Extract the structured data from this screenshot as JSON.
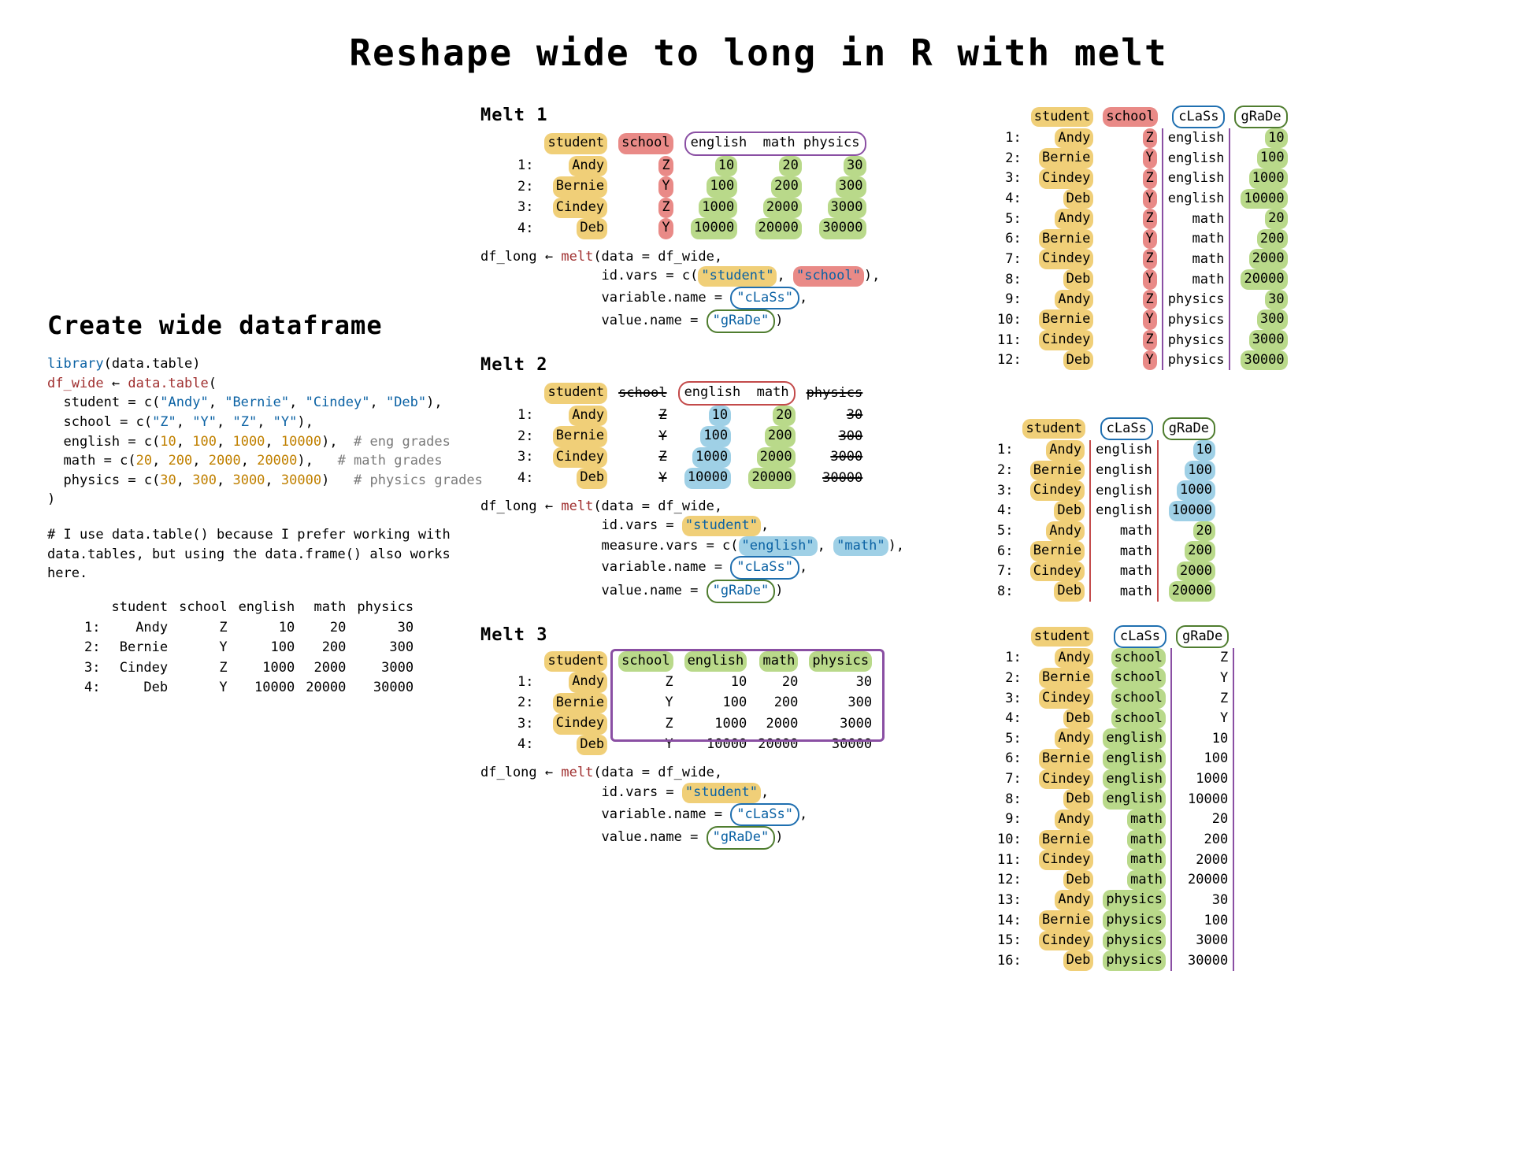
{
  "title": "Reshape wide to long in R with melt",
  "left": {
    "heading": "Create wide dataframe",
    "code": "library(data.table)\ndf_wide ← data.table(\n  student = c(\"Andy\", \"Bernie\", \"Cindey\", \"Deb\"),\n  school = c(\"Z\", \"Y\", \"Z\", \"Y\"),\n  english = c(10, 100, 1000, 10000),  # eng grades\n  math = c(20, 200, 2000, 20000),   # math grades\n  physics = c(30, 300, 3000, 30000)   # physics grades\n)",
    "note_pre": "# I use ",
    "note_dt": "data.table()",
    "note_mid": " because I prefer working with data.tables, but using the ",
    "note_df": "data.frame()",
    "note_post": " also works here.",
    "wide_table": {
      "headers": [
        "",
        "student",
        "school",
        "english",
        "math",
        "physics"
      ],
      "rows": [
        [
          "1:",
          "Andy",
          "Z",
          "10",
          "20",
          "30"
        ],
        [
          "2:",
          "Bernie",
          "Y",
          "100",
          "200",
          "300"
        ],
        [
          "3:",
          "Cindey",
          "Z",
          "1000",
          "2000",
          "3000"
        ],
        [
          "4:",
          "Deb",
          "Y",
          "10000",
          "20000",
          "30000"
        ]
      ]
    }
  },
  "melt1": {
    "heading": "Melt 1",
    "input_headers": [
      "",
      "student",
      "school",
      "english",
      "math",
      "physics"
    ],
    "input_rows": [
      [
        "1:",
        "Andy",
        "Z",
        "10",
        "20",
        "30"
      ],
      [
        "2:",
        "Bernie",
        "Y",
        "100",
        "200",
        "300"
      ],
      [
        "3:",
        "Cindey",
        "Z",
        "1000",
        "2000",
        "3000"
      ],
      [
        "4:",
        "Deb",
        "Y",
        "10000",
        "20000",
        "30000"
      ]
    ],
    "call_lines": {
      "l1_a": "df_long ← ",
      "l1_b": "melt",
      "l1_c": "(data = df_wide,",
      "l2_a": "id.vars = c(",
      "l2_s1": "\"student\"",
      "l2_b": ", ",
      "l2_s2": "\"school\"",
      "l2_c": "),",
      "l3_a": "variable.name = ",
      "l3_v": "\"cLaSs\"",
      "l3_c": ",",
      "l4_a": "value.name = ",
      "l4_v": "\"gRaDe\"",
      "l4_c": ")"
    },
    "out_headers": [
      "",
      "student",
      "school",
      "cLaSs",
      "gRaDe"
    ],
    "out_rows": [
      [
        "1:",
        "Andy",
        "Z",
        "english",
        "10"
      ],
      [
        "2:",
        "Bernie",
        "Y",
        "english",
        "100"
      ],
      [
        "3:",
        "Cindey",
        "Z",
        "english",
        "1000"
      ],
      [
        "4:",
        "Deb",
        "Y",
        "english",
        "10000"
      ],
      [
        "5:",
        "Andy",
        "Z",
        "math",
        "20"
      ],
      [
        "6:",
        "Bernie",
        "Y",
        "math",
        "200"
      ],
      [
        "7:",
        "Cindey",
        "Z",
        "math",
        "2000"
      ],
      [
        "8:",
        "Deb",
        "Y",
        "math",
        "20000"
      ],
      [
        "9:",
        "Andy",
        "Z",
        "physics",
        "30"
      ],
      [
        "10:",
        "Bernie",
        "Y",
        "physics",
        "300"
      ],
      [
        "11:",
        "Cindey",
        "Z",
        "physics",
        "3000"
      ],
      [
        "12:",
        "Deb",
        "Y",
        "physics",
        "30000"
      ]
    ]
  },
  "melt2": {
    "heading": "Melt 2",
    "input_headers": [
      "",
      "student",
      "school",
      "english",
      "math",
      "physics"
    ],
    "input_rows": [
      [
        "1:",
        "Andy",
        "Z",
        "10",
        "20",
        "30"
      ],
      [
        "2:",
        "Bernie",
        "Y",
        "100",
        "200",
        "300"
      ],
      [
        "3:",
        "Cindey",
        "Z",
        "1000",
        "2000",
        "3000"
      ],
      [
        "4:",
        "Deb",
        "Y",
        "10000",
        "20000",
        "30000"
      ]
    ],
    "call_lines": {
      "l1_a": "df_long ← ",
      "l1_b": "melt",
      "l1_c": "(data = df_wide,",
      "l2_a": "id.vars = ",
      "l2_v": "\"student\"",
      "l2_c": ",",
      "l3_a": "measure.vars = c(",
      "l3_v1": "\"english\"",
      "l3_b": ", ",
      "l3_v2": "\"math\"",
      "l3_c": "),",
      "l4_a": "variable.name = ",
      "l4_v": "\"cLaSs\"",
      "l4_c": ",",
      "l5_a": "value.name = ",
      "l5_v": "\"gRaDe\"",
      "l5_c": ")"
    },
    "out_headers": [
      "",
      "student",
      "cLaSs",
      "gRaDe"
    ],
    "out_rows": [
      [
        "1:",
        "Andy",
        "english",
        "10"
      ],
      [
        "2:",
        "Bernie",
        "english",
        "100"
      ],
      [
        "3:",
        "Cindey",
        "english",
        "1000"
      ],
      [
        "4:",
        "Deb",
        "english",
        "10000"
      ],
      [
        "5:",
        "Andy",
        "math",
        "20"
      ],
      [
        "6:",
        "Bernie",
        "math",
        "200"
      ],
      [
        "7:",
        "Cindey",
        "math",
        "2000"
      ],
      [
        "8:",
        "Deb",
        "math",
        "20000"
      ]
    ]
  },
  "melt3": {
    "heading": "Melt 3",
    "input_headers": [
      "",
      "student",
      "school",
      "english",
      "math",
      "physics"
    ],
    "input_rows": [
      [
        "1:",
        "Andy",
        "Z",
        "10",
        "20",
        "30"
      ],
      [
        "2:",
        "Bernie",
        "Y",
        "100",
        "200",
        "300"
      ],
      [
        "3:",
        "Cindey",
        "Z",
        "1000",
        "2000",
        "3000"
      ],
      [
        "4:",
        "Deb",
        "Y",
        "10000",
        "20000",
        "30000"
      ]
    ],
    "call_lines": {
      "l1_a": "df_long ← ",
      "l1_b": "melt",
      "l1_c": "(data = df_wide,",
      "l2_a": "id.vars = ",
      "l2_v": "\"student\"",
      "l2_c": ",",
      "l3_a": "variable.name = ",
      "l3_v": "\"cLaSs\"",
      "l3_c": ",",
      "l4_a": "value.name = ",
      "l4_v": "\"gRaDe\"",
      "l4_c": ")"
    },
    "out_headers": [
      "",
      "student",
      "cLaSs",
      "gRaDe"
    ],
    "out_rows": [
      [
        "1:",
        "Andy",
        "school",
        "Z"
      ],
      [
        "2:",
        "Bernie",
        "school",
        "Y"
      ],
      [
        "3:",
        "Cindey",
        "school",
        "Z"
      ],
      [
        "4:",
        "Deb",
        "school",
        "Y"
      ],
      [
        "5:",
        "Andy",
        "english",
        "10"
      ],
      [
        "6:",
        "Bernie",
        "english",
        "100"
      ],
      [
        "7:",
        "Cindey",
        "english",
        "1000"
      ],
      [
        "8:",
        "Deb",
        "english",
        "10000"
      ],
      [
        "9:",
        "Andy",
        "math",
        "20"
      ],
      [
        "10:",
        "Bernie",
        "math",
        "200"
      ],
      [
        "11:",
        "Cindey",
        "math",
        "2000"
      ],
      [
        "12:",
        "Deb",
        "math",
        "20000"
      ],
      [
        "13:",
        "Andy",
        "physics",
        "30"
      ],
      [
        "14:",
        "Bernie",
        "physics",
        "100"
      ],
      [
        "15:",
        "Cindey",
        "physics",
        "3000"
      ],
      [
        "16:",
        "Deb",
        "physics",
        "30000"
      ]
    ]
  }
}
